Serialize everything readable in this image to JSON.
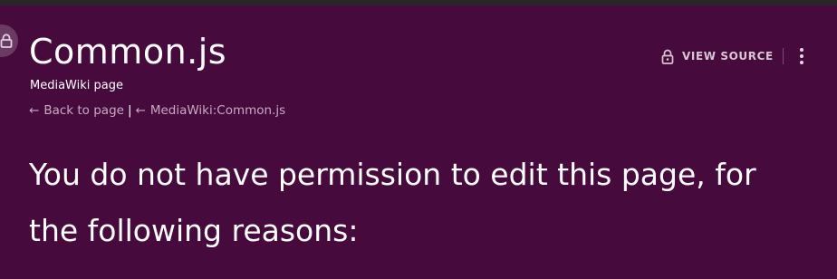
{
  "header": {
    "title": "Common.js",
    "subtitle": "MediaWiki page"
  },
  "breadcrumbs": {
    "back_label": "Back to page",
    "separator": "|",
    "source_label": "MediaWiki:Common.js",
    "arrow_left": "←"
  },
  "actions": {
    "view_source_label": "VIEW SOURCE"
  },
  "main": {
    "message": "You do not have permission to edit this page, for the following reasons:"
  },
  "icons": {
    "badge": "lock-icon",
    "view_source": "lock-icon",
    "more": "kebab-menu-icon"
  },
  "colors": {
    "background": "#470a3d",
    "text": "#ffffff",
    "muted_link": "#c8a9c2"
  }
}
